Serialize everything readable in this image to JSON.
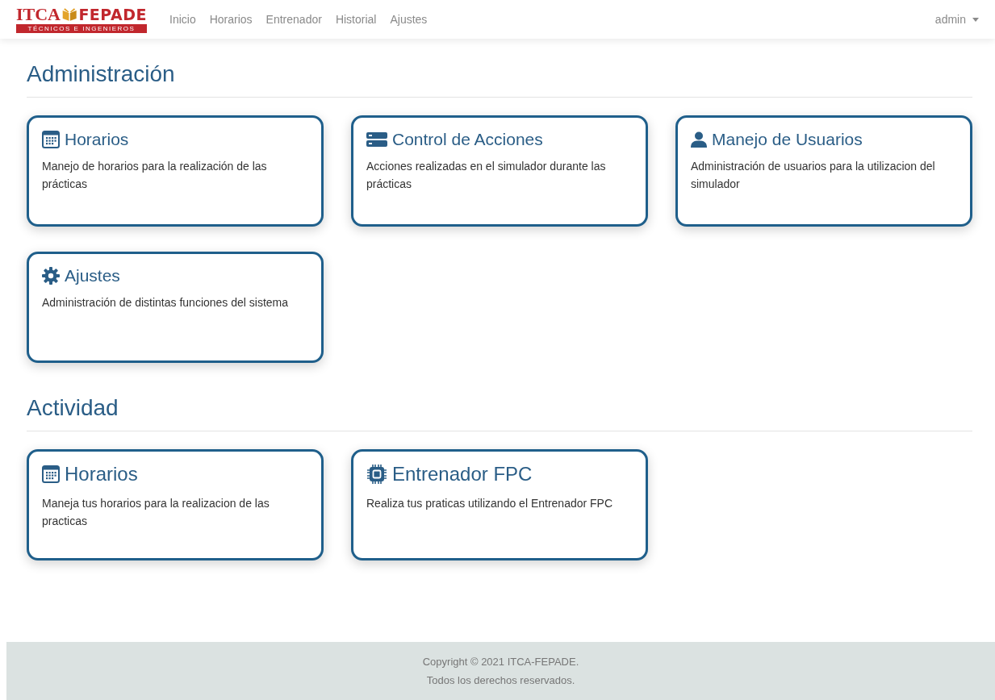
{
  "navbar": {
    "logo": {
      "left": "ITCA",
      "right": "FEPADE",
      "tagline": "TÉCNICOS E INGENIEROS"
    },
    "links": [
      {
        "label": "Inicio"
      },
      {
        "label": "Horarios"
      },
      {
        "label": "Entrenador"
      },
      {
        "label": "Historial"
      },
      {
        "label": "Ajustes"
      }
    ],
    "user_menu": {
      "label": "admin"
    }
  },
  "sections": [
    {
      "title": "Administración",
      "large": false,
      "cards": [
        {
          "kind": "calendar",
          "title": "Horarios",
          "text": "Manejo de horarios para la realización de las prácticas"
        },
        {
          "kind": "server",
          "title": "Control de Acciones",
          "text": "Acciones realizadas en el simulador durante las prácticas"
        },
        {
          "kind": "user",
          "title": "Manejo de Usuarios",
          "text": "Administración de usuarios para la utilizacion del simulador"
        },
        {
          "kind": "gear",
          "title": "Ajustes",
          "text": "Administración de distintas funciones del sistema"
        }
      ]
    },
    {
      "title": "Actividad",
      "large": true,
      "cards": [
        {
          "kind": "calendar",
          "title": "Horarios",
          "text": "Maneja tus horarios para la realizacion de las practicas"
        },
        {
          "kind": "chip",
          "title": "Entrenador FPC",
          "text": "Realiza tus praticas utilizando el Entrenador FPC"
        }
      ]
    }
  ],
  "footer": {
    "lines": [
      "Copyright © 2021 ITCA-FEPADE.",
      "Todos los derechos reservados."
    ]
  }
}
